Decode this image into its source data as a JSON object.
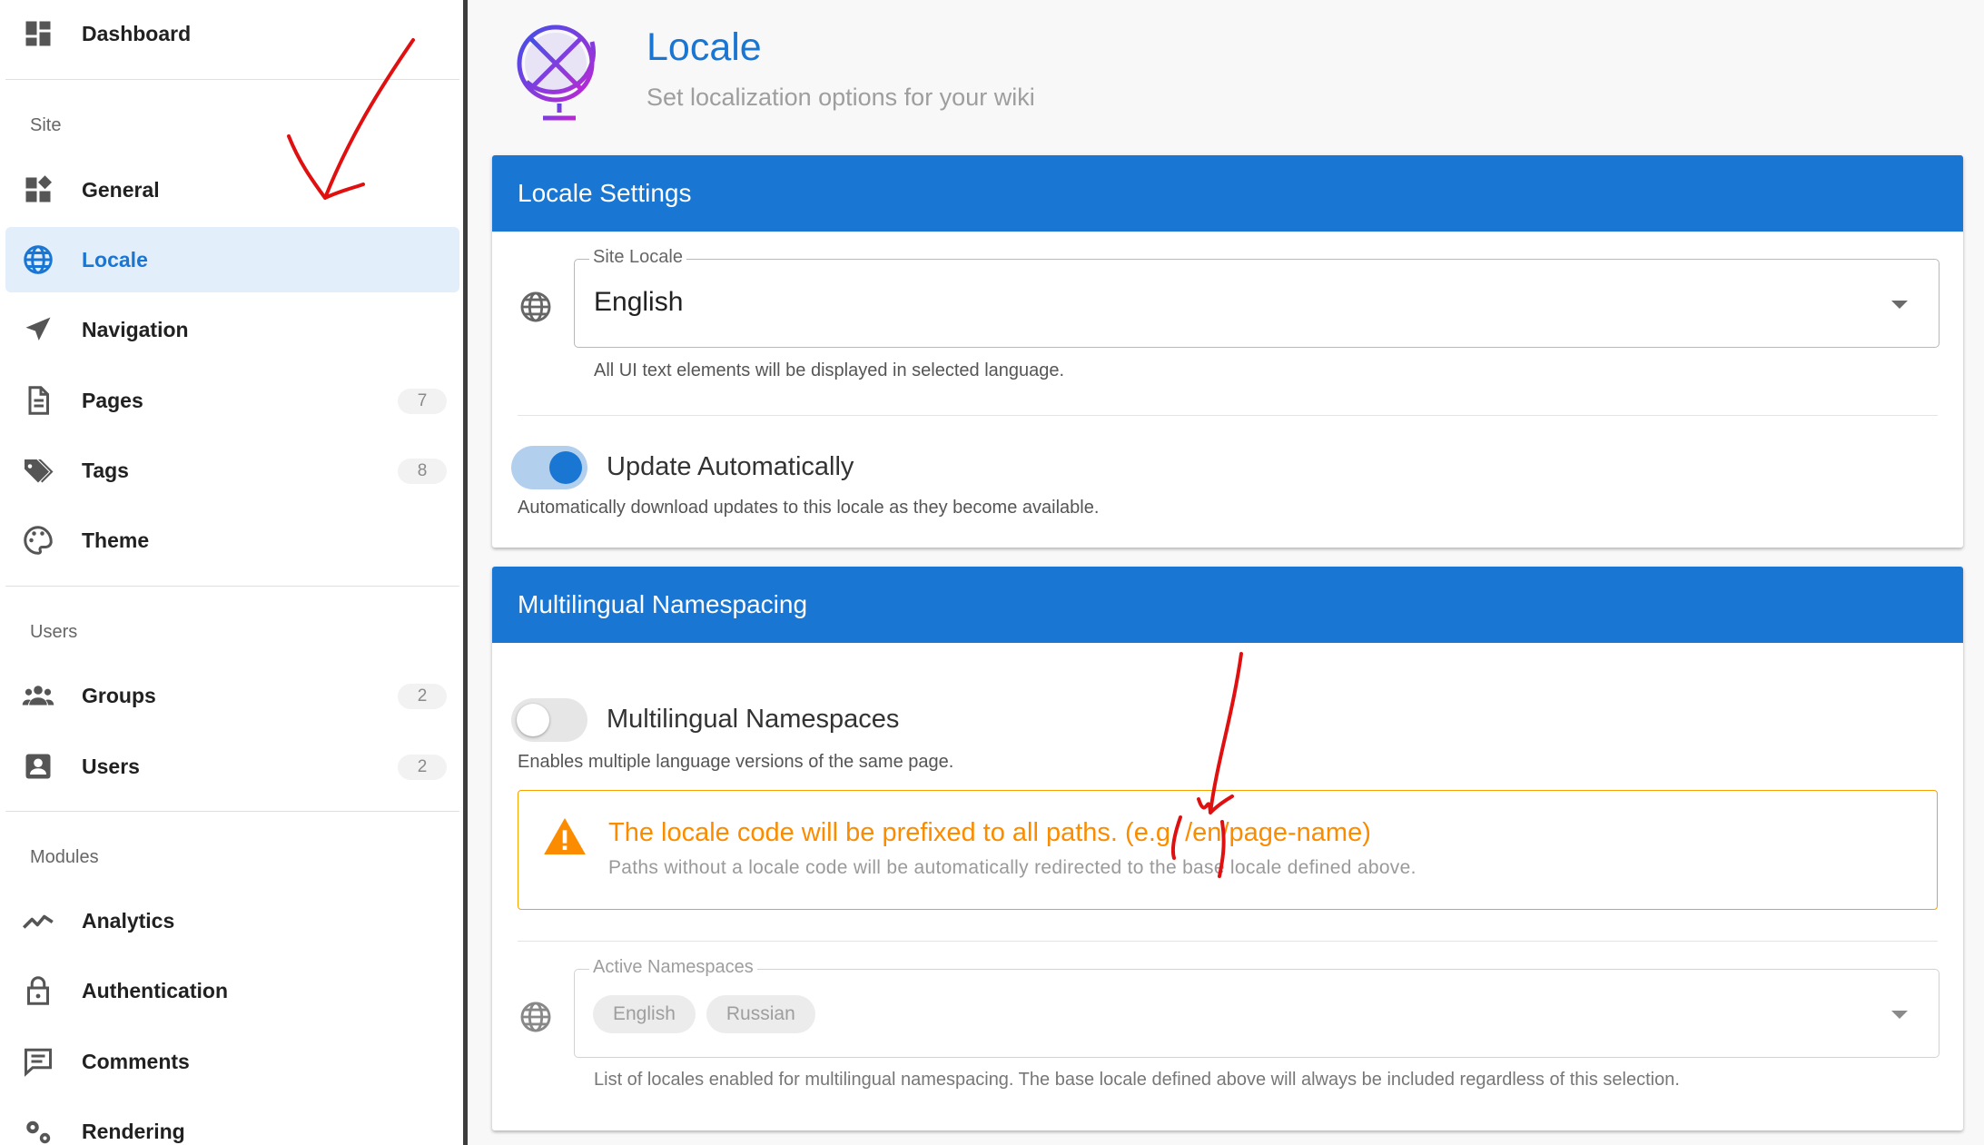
{
  "sidebar": {
    "dashboard": {
      "label": "Dashboard",
      "icon": "dashboard-icon"
    },
    "sections": {
      "site": "Site",
      "users": "Users",
      "modules": "Modules"
    },
    "site_items": [
      {
        "label": "General",
        "icon": "widgets-icon"
      },
      {
        "label": "Locale",
        "icon": "globe-icon",
        "active": true
      },
      {
        "label": "Navigation",
        "icon": "navigation-arrow-icon"
      },
      {
        "label": "Pages",
        "icon": "page-icon",
        "badge": "7"
      },
      {
        "label": "Tags",
        "icon": "tags-icon",
        "badge": "8"
      },
      {
        "label": "Theme",
        "icon": "palette-icon"
      }
    ],
    "user_items": [
      {
        "label": "Groups",
        "icon": "groups-icon",
        "badge": "2"
      },
      {
        "label": "Users",
        "icon": "user-account-icon",
        "badge": "2"
      }
    ],
    "module_items": [
      {
        "label": "Analytics",
        "icon": "analytics-icon"
      },
      {
        "label": "Authentication",
        "icon": "lock-icon"
      },
      {
        "label": "Comments",
        "icon": "comment-icon"
      },
      {
        "label": "Rendering",
        "icon": "gears-icon"
      }
    ]
  },
  "header": {
    "title": "Locale",
    "subtitle": "Set localization options for your wiki",
    "icon": "globe-stand-icon"
  },
  "locale_settings": {
    "title": "Locale Settings",
    "site_locale": {
      "legend": "Site Locale",
      "value": "English",
      "hint": "All UI text elements will be displayed in selected language."
    },
    "auto_update": {
      "label": "Update Automatically",
      "enabled": true,
      "hint": "Automatically download updates to this locale as they become available."
    }
  },
  "namespacing": {
    "title": "Multilingual Namespacing",
    "toggle": {
      "label": "Multilingual Namespaces",
      "enabled": false,
      "hint": "Enables multiple language versions of the same page."
    },
    "alert": {
      "icon": "warning-icon",
      "title": "The locale code will be prefixed to all paths. (e.g. /en/page-name)",
      "subtitle": "Paths without a locale code will be automatically redirected to the base locale defined above."
    },
    "active_namespaces": {
      "legend": "Active Namespaces",
      "chips": [
        "English",
        "Russian"
      ],
      "hint": "List of locales enabled for multilingual namespacing. The base locale defined above will always be included regardless of this selection."
    }
  },
  "colors": {
    "primary": "#1976d2",
    "active_bg": "#e3eefb",
    "warning": "#fb8c00",
    "annotation": "#e01010"
  }
}
